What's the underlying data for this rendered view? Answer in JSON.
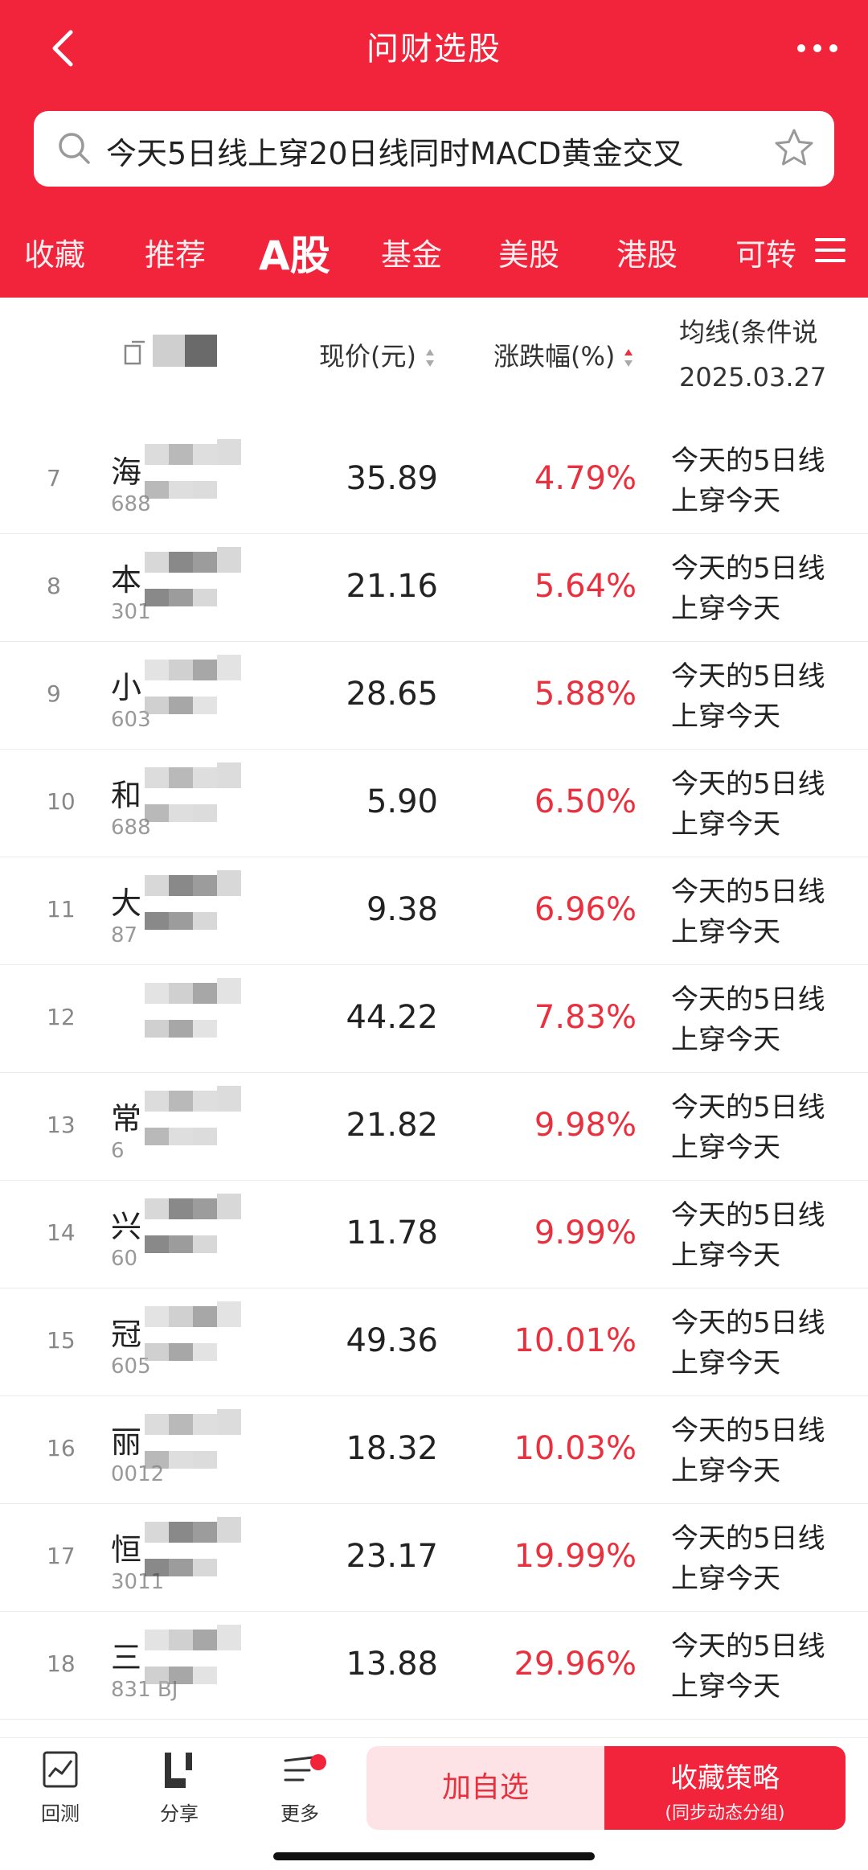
{
  "app": {
    "title": "问财选股",
    "search_query": "今天5日线上穿20日线同时MACD黄金交叉"
  },
  "tabs": [
    {
      "label": "收藏",
      "active": false
    },
    {
      "label": "推荐",
      "active": false
    },
    {
      "label": "A股",
      "active": true
    },
    {
      "label": "基金",
      "active": false
    },
    {
      "label": "美股",
      "active": false
    },
    {
      "label": "港股",
      "active": false
    },
    {
      "label": "可转",
      "active": false
    }
  ],
  "table": {
    "headers": {
      "price": "现价(元)",
      "change": "涨跌幅(%)",
      "condition": "均线(条件说",
      "condition_date": "2025.03.27"
    },
    "rows": [
      {
        "idx": "7",
        "name": "海",
        "code": "688",
        "price": "35.89",
        "change": "4.79%",
        "condition": "今天的5日线上穿今天"
      },
      {
        "idx": "8",
        "name": "本",
        "code": "301",
        "price": "21.16",
        "change": "5.64%",
        "condition": "今天的5日线上穿今天"
      },
      {
        "idx": "9",
        "name": "小",
        "code": "603",
        "price": "28.65",
        "change": "5.88%",
        "condition": "今天的5日线上穿今天"
      },
      {
        "idx": "10",
        "name": "和",
        "code": "688",
        "price": "5.90",
        "change": "6.50%",
        "condition": "今天的5日线上穿今天"
      },
      {
        "idx": "11",
        "name": "大",
        "code": "87",
        "price": "9.38",
        "change": "6.96%",
        "condition": "今天的5日线上穿今天"
      },
      {
        "idx": "12",
        "name": "",
        "code": "",
        "price": "44.22",
        "change": "7.83%",
        "condition": "今天的5日线上穿今天"
      },
      {
        "idx": "13",
        "name": "常",
        "code": "6",
        "price": "21.82",
        "change": "9.98%",
        "condition": "今天的5日线上穿今天"
      },
      {
        "idx": "14",
        "name": "兴",
        "code": "60",
        "price": "11.78",
        "change": "9.99%",
        "condition": "今天的5日线上穿今天"
      },
      {
        "idx": "15",
        "name": "冠",
        "code": "605",
        "price": "49.36",
        "change": "10.01%",
        "condition": "今天的5日线上穿今天"
      },
      {
        "idx": "16",
        "name": "丽",
        "code": "0012",
        "price": "18.32",
        "change": "10.03%",
        "condition": "今天的5日线上穿今天"
      },
      {
        "idx": "17",
        "name": "恒",
        "code": "3011",
        "price": "23.17",
        "change": "19.99%",
        "condition": "今天的5日线上穿今天"
      },
      {
        "idx": "18",
        "name": "三",
        "code": "831 BJ",
        "price": "13.88",
        "change": "29.96%",
        "condition": "今天的5日线上穿今天"
      }
    ]
  },
  "bottom_bar": {
    "backtest": "回测",
    "share": "分享",
    "more": "更多",
    "add_watch": "加自选",
    "save_strategy": "收藏策略",
    "save_strategy_sub": "(同步动态分组)"
  },
  "colors": {
    "brand_red": "#f2243b",
    "up_red": "#e8303e"
  }
}
